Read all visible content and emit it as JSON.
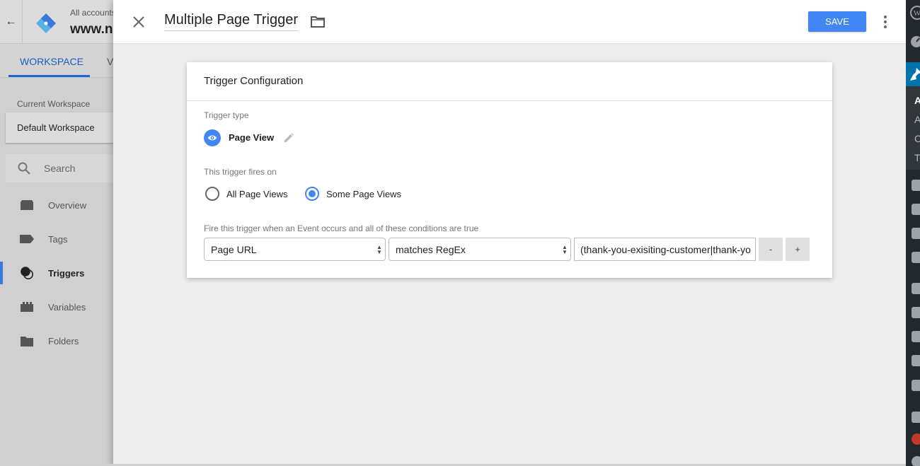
{
  "gtm": {
    "account_label": "All accounts",
    "container_name": "www.n",
    "tabs": [
      {
        "label": "WORKSPACE",
        "active": true
      },
      {
        "label": "V",
        "active": false
      }
    ],
    "current_workspace_label": "Current Workspace",
    "current_workspace": "Default Workspace",
    "search_placeholder": "Search",
    "nav": [
      {
        "label": "Overview",
        "icon": "overview-icon"
      },
      {
        "label": "Tags",
        "icon": "tag-icon"
      },
      {
        "label": "Triggers",
        "icon": "trigger-icon",
        "active": true
      },
      {
        "label": "Variables",
        "icon": "variables-icon"
      },
      {
        "label": "Folders",
        "icon": "folder-icon"
      }
    ]
  },
  "editor": {
    "title": "Multiple Page Trigger",
    "save_label": "SAVE",
    "card_title": "Trigger Configuration",
    "trigger_type_label": "Trigger type",
    "trigger_type": "Page View",
    "fires_on_label": "This trigger fires on",
    "fires_on_options": [
      {
        "label": "All Page Views",
        "checked": false
      },
      {
        "label": "Some Page Views",
        "checked": true
      }
    ],
    "condition_label": "Fire this trigger when an Event occurs and all of these conditions are true",
    "condition": {
      "variable": "Page URL",
      "operator": "matches RegEx",
      "value": "(thank-you-exisiting-customer|thank-yo"
    },
    "remove_label": "-",
    "add_label": "+"
  },
  "wp_sidebar": {
    "submenu": [
      "A",
      "A",
      "C",
      "T"
    ]
  },
  "colors": {
    "accent": "#4285f4",
    "gtm_tab": "#1a66d6",
    "wp_active": "#0073aa",
    "wp_bg": "#23282d"
  }
}
